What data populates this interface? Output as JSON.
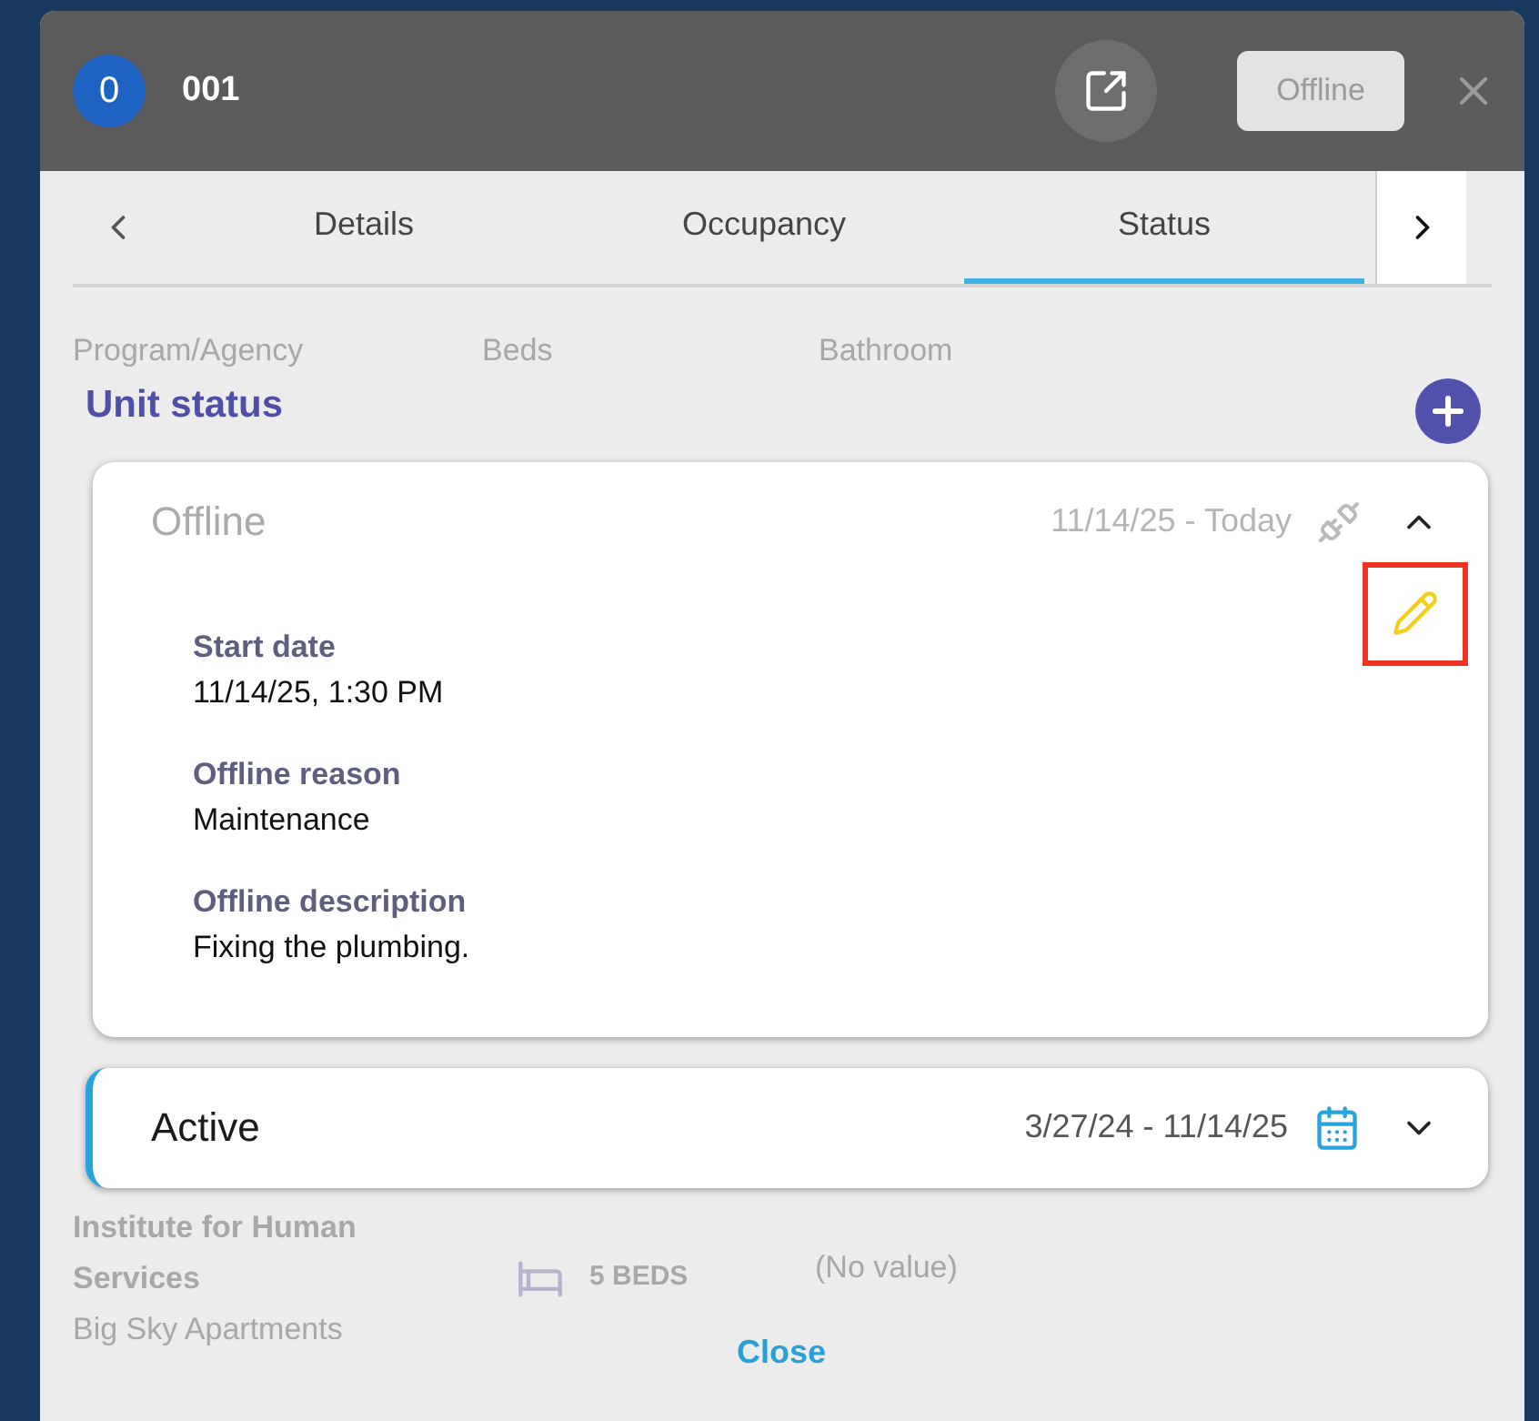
{
  "header": {
    "badge": "0",
    "title": "001",
    "status_button": "Offline"
  },
  "tabs": [
    {
      "label": "Details",
      "selected": false
    },
    {
      "label": "Occupancy",
      "selected": false
    },
    {
      "label": "Status",
      "selected": true
    }
  ],
  "background_list": {
    "columns": [
      "Program/Agency",
      "Beds",
      "Bathroom"
    ],
    "row": {
      "program": "Institute for Human Services",
      "site": "Big Sky Apartments",
      "beds": "5 BEDS",
      "bathroom": "(No value)"
    }
  },
  "unit_status": {
    "title": "Unit status",
    "entries": [
      {
        "kind": "offline",
        "status": "Offline",
        "range": "11/14/25 - Today",
        "expanded": true,
        "fields": [
          {
            "label": "Start date",
            "value": "11/14/25, 1:30 PM"
          },
          {
            "label": "Offline reason",
            "value": "Maintenance"
          },
          {
            "label": "Offline description",
            "value": "Fixing the plumbing."
          }
        ]
      },
      {
        "kind": "active",
        "status": "Active",
        "range": "3/27/24 - 11/14/25",
        "expanded": false
      }
    ]
  },
  "footer": {
    "close": "Close"
  }
}
